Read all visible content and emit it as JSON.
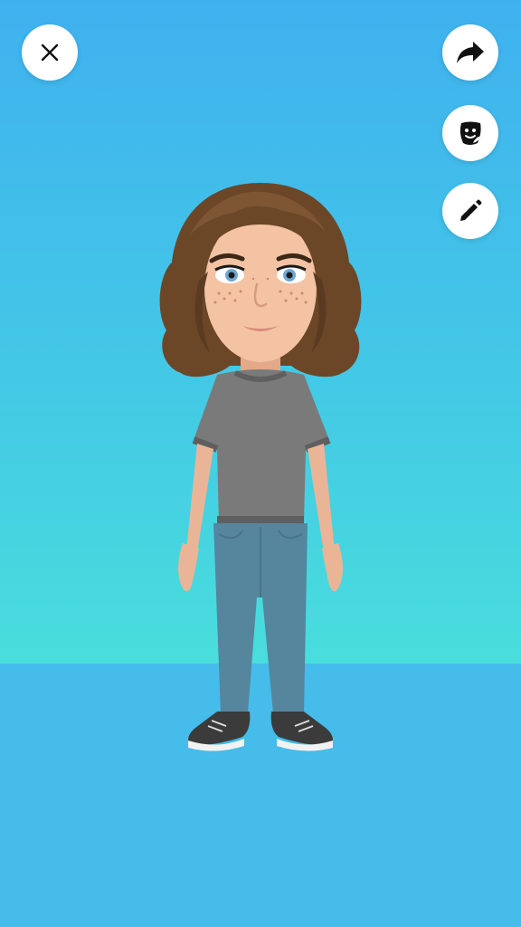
{
  "toolbar": {
    "close": {
      "icon": "close-icon"
    },
    "share": {
      "icon": "share-arrow-icon"
    },
    "stickers": {
      "icon": "avatar-sticker-icon"
    },
    "edit": {
      "icon": "pencil-icon"
    }
  },
  "scene": {
    "avatar": {
      "description_icon": "avatar-figure"
    },
    "colors": {
      "sky_top": "#3FB1EF",
      "sky_bottom": "#49DEDC",
      "floor": "#45BCEA",
      "button_bg": "#FFFFFF",
      "icon": "#111111"
    }
  }
}
